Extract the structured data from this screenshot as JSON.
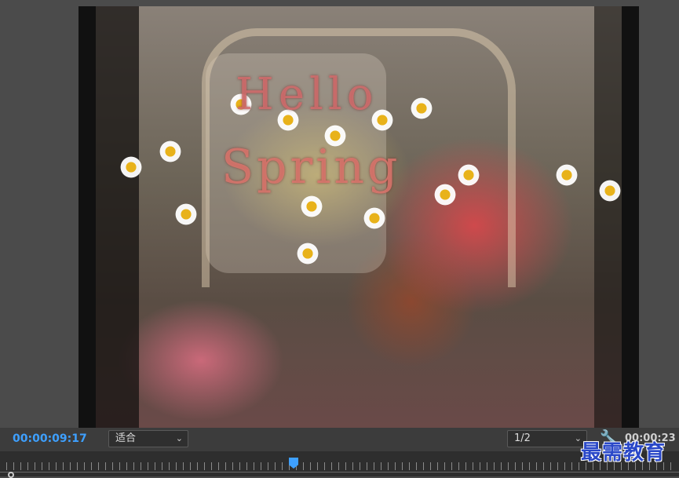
{
  "preview": {
    "overlay_text_line1": "Hello",
    "overlay_text_line2": "Spring"
  },
  "controls": {
    "current_timecode": "00:00:09:17",
    "zoom_fit": "适合",
    "playback_resolution": "1/2",
    "duration_timecode": "00:00:23",
    "settings_icon": "wrench-icon",
    "dropdown_icon": "chevron-down-icon"
  },
  "timeline": {
    "playhead_color": "#3ea0ff"
  },
  "watermark": {
    "text": "最需教育"
  },
  "colors": {
    "timecode": "#3ea0ff",
    "panel_bg": "#4a4a4a",
    "watermark": "#2a48c8"
  }
}
